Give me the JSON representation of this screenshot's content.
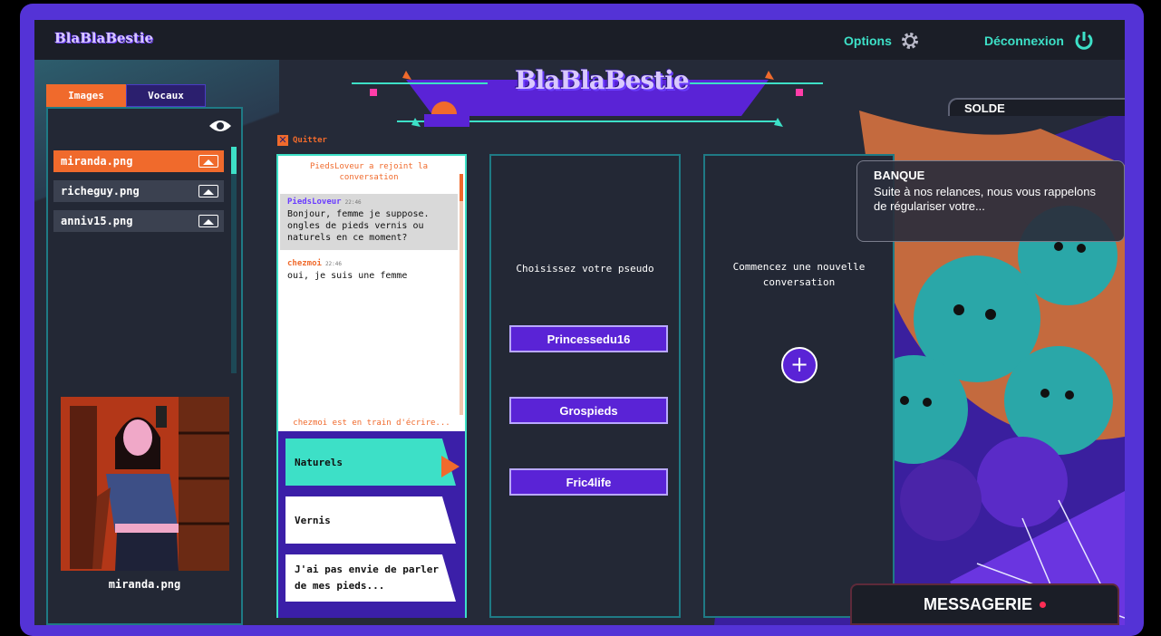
{
  "app": {
    "logo": "BlaBlaBestie",
    "big_title": "BlaBlaBestie"
  },
  "topbar": {
    "options_label": "Options",
    "logout_label": "Déconnexion"
  },
  "left_panel": {
    "tabs": [
      {
        "label": "Images"
      },
      {
        "label": "Vocaux"
      }
    ],
    "files": [
      {
        "name": "miranda.png"
      },
      {
        "name": "richeguy.png"
      },
      {
        "name": "anniv15.png"
      }
    ],
    "preview_name": "miranda.png"
  },
  "solde_label": "SOLDE",
  "quit_label": "Quitter",
  "chat": {
    "joined_text": "PiedsLoveur a rejoint la conversation",
    "messages": [
      {
        "author": "PiedsLoveur",
        "time": "22:46",
        "text": "Bonjour, femme je suppose. ongles de pieds vernis ou naturels en ce moment?"
      },
      {
        "author": "chezmoi",
        "time": "22:46",
        "text": "oui, je suis une femme"
      }
    ],
    "typing": "chezmoi est en train d'écrire...",
    "answers": [
      {
        "label": "Naturels"
      },
      {
        "label": "Vernis"
      },
      {
        "label": "J'ai pas envie de parler de mes pieds..."
      }
    ]
  },
  "pseudo": {
    "title": "Choisissez votre pseudo",
    "options": [
      "Princessedu16",
      "Grospieds",
      "Fric4life"
    ]
  },
  "new_conversation": {
    "title": "Commencez une nouvelle conversation",
    "plus": "+"
  },
  "notification": {
    "sender": "BANQUE",
    "text": "Suite à nos relances, nous vous rappelons de régulariser votre..."
  },
  "messagerie_label": "MESSAGERIE",
  "colors": {
    "accent": "#3de0c7",
    "orange": "#f06a2c",
    "purple": "#5a23d6",
    "frame": "#5433d6"
  }
}
